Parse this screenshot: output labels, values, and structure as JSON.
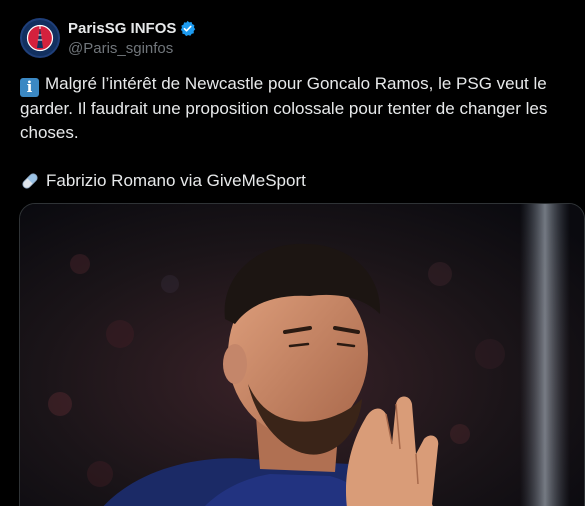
{
  "account": {
    "display_name": "ParisSG INFOS",
    "handle": "@Paris_sginfos",
    "verified": true,
    "avatar_icon": "psg-crest-icon"
  },
  "tweet": {
    "info_emoji": "i",
    "text": "Malgré l’intérêt de Newcastle pour Goncalo Ramos, le PSG veut le garder. Il faudrait une proposition colossale pour tenter de changer les choses.",
    "credit_icon": "pill-icon",
    "credit": "Fabrizio Romano via GiveMeSport"
  },
  "media": {
    "type": "photo",
    "subject_icon": "player-photo"
  },
  "colors": {
    "background": "#000000",
    "text": "#e7e9ea",
    "muted": "#71767b",
    "verified": "#1d9bf0",
    "psg_blue": "#12305f",
    "psg_red": "#d4213d"
  }
}
